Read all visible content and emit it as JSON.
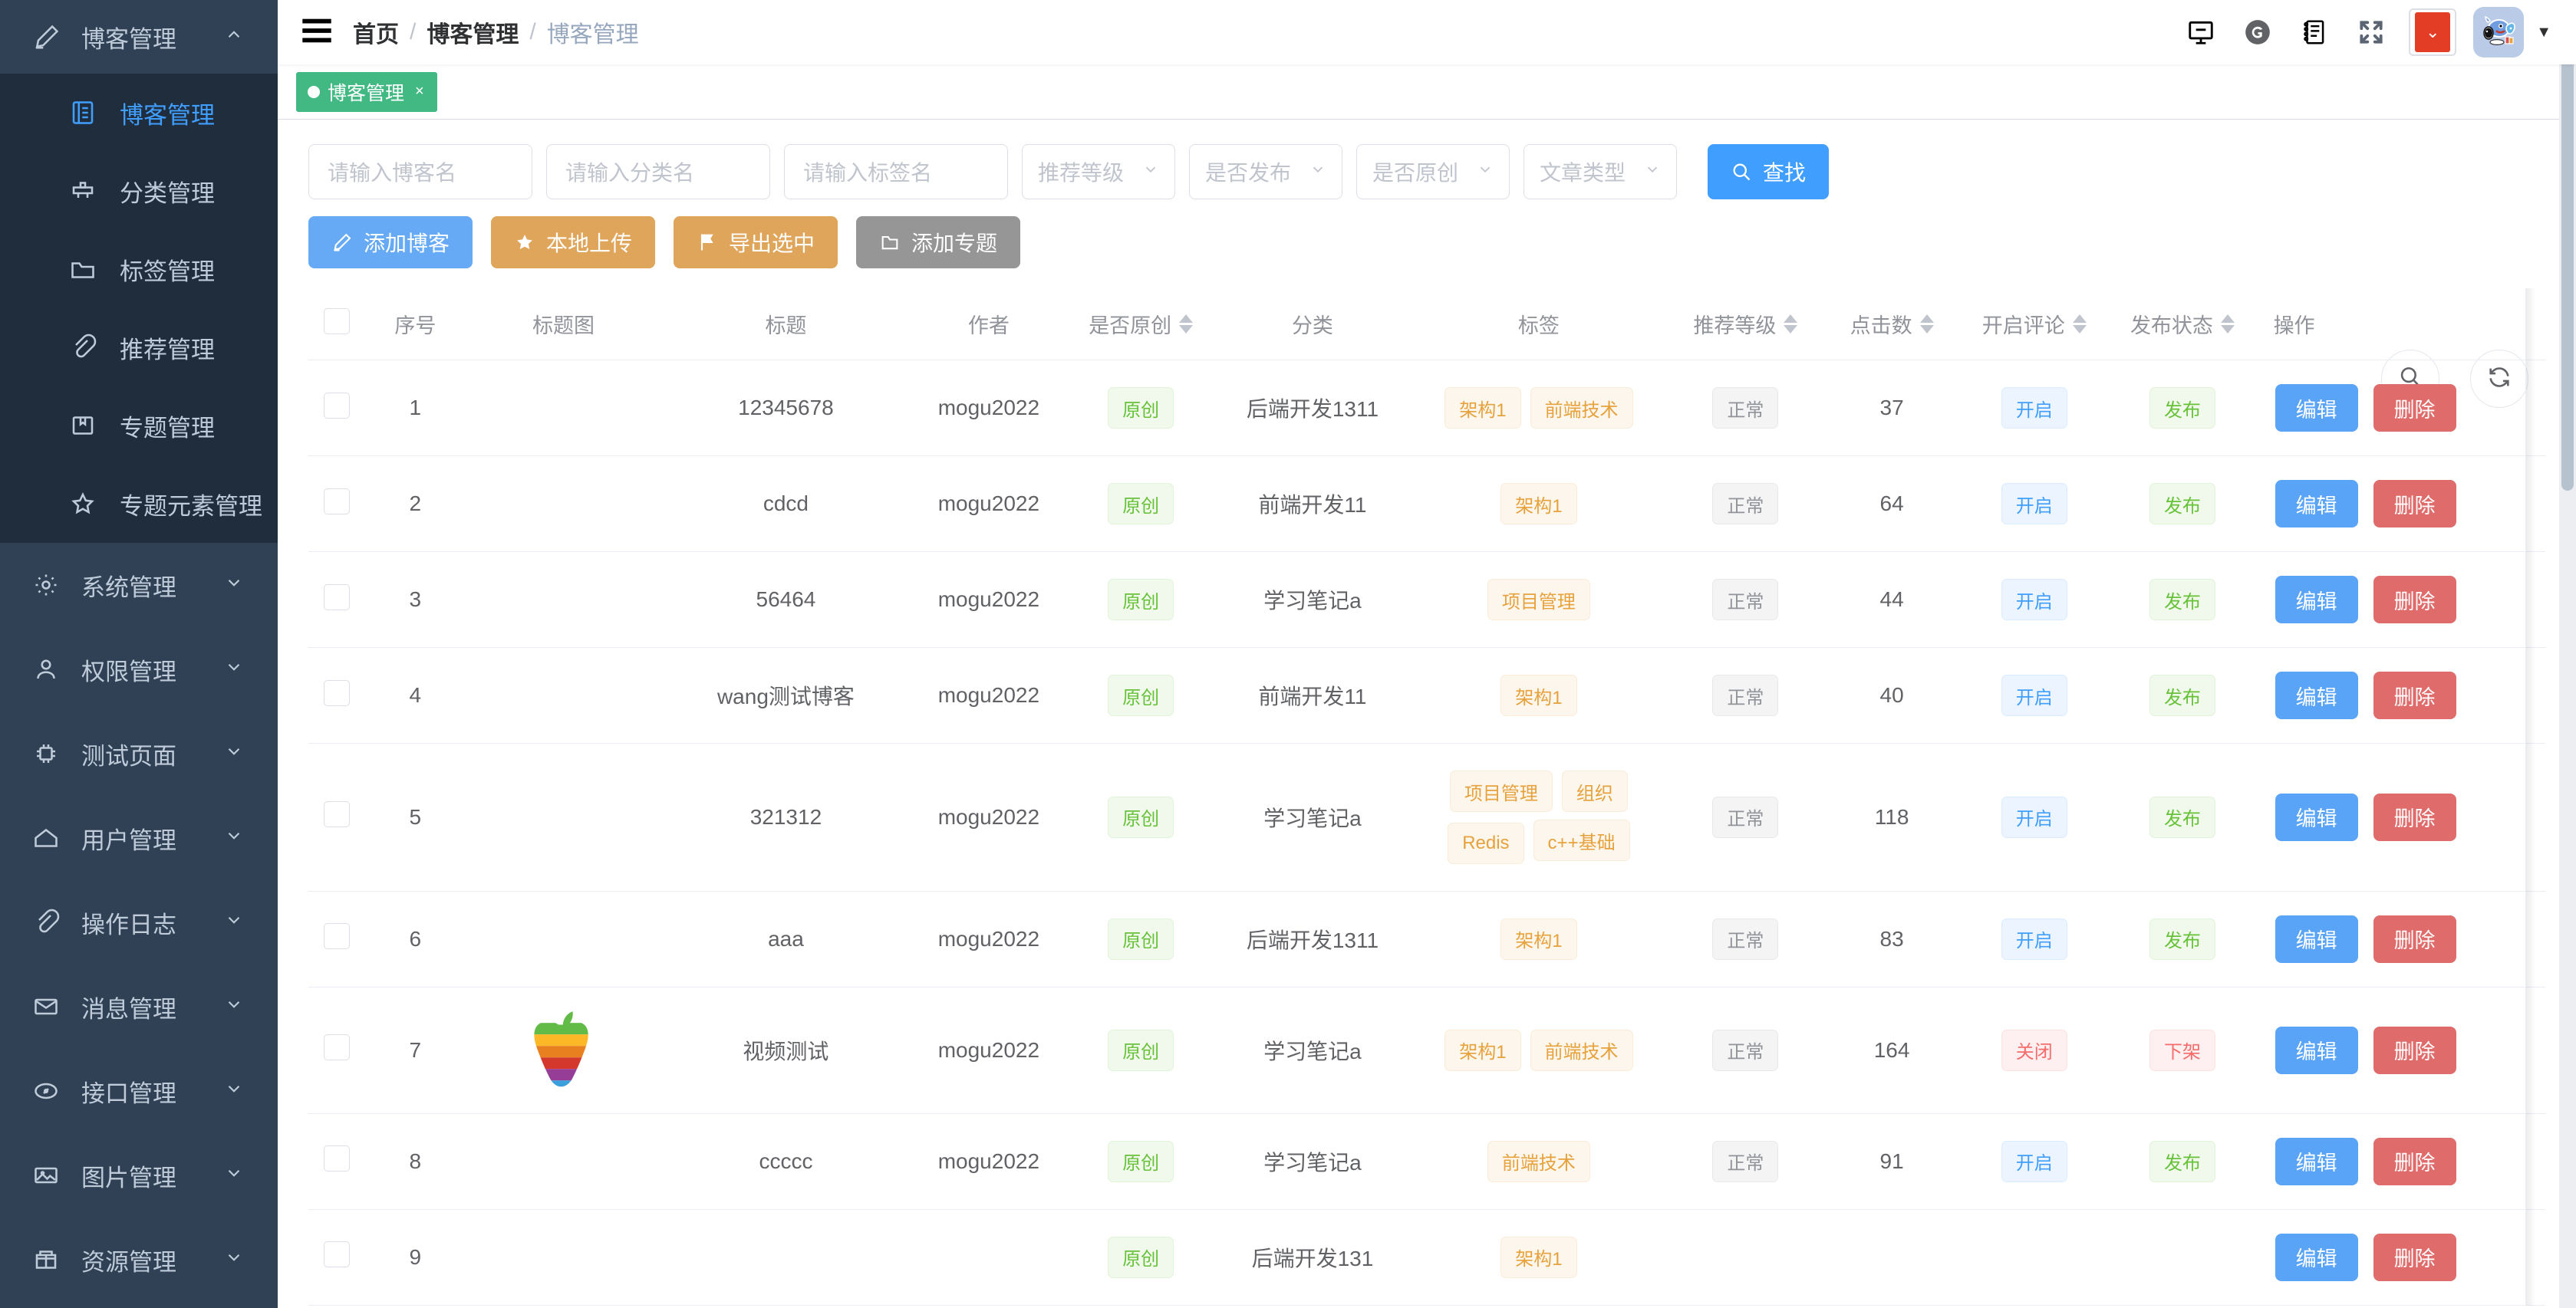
{
  "sidebar": {
    "group": {
      "label": "博客管理",
      "icon": "pencil-icon",
      "arrow": "chevron-up-icon"
    },
    "sub_items": [
      {
        "label": "博客管理",
        "icon": "book-icon",
        "active": true
      },
      {
        "label": "分类管理",
        "icon": "category-icon",
        "active": false
      },
      {
        "label": "标签管理",
        "icon": "folder-icon",
        "active": false
      },
      {
        "label": "推荐管理",
        "icon": "paperclip-icon",
        "active": false
      },
      {
        "label": "专题管理",
        "icon": "bookmark-icon",
        "active": false
      },
      {
        "label": "专题元素管理",
        "icon": "star-icon",
        "active": false
      }
    ],
    "root_items": [
      {
        "label": "系统管理",
        "icon": "gear-icon"
      },
      {
        "label": "权限管理",
        "icon": "user-icon"
      },
      {
        "label": "测试页面",
        "icon": "chip-icon"
      },
      {
        "label": "用户管理",
        "icon": "home-icon"
      },
      {
        "label": "操作日志",
        "icon": "paperclip-icon"
      },
      {
        "label": "消息管理",
        "icon": "envelope-icon"
      },
      {
        "label": "接口管理",
        "icon": "gauge-icon"
      },
      {
        "label": "图片管理",
        "icon": "image-icon"
      },
      {
        "label": "资源管理",
        "icon": "archive-icon"
      }
    ]
  },
  "navbar": {
    "hamburger_icon": "hamburger-icon",
    "breadcrumb": [
      {
        "label": "首页",
        "current": false
      },
      {
        "label": "博客管理",
        "current": false
      },
      {
        "label": "博客管理",
        "current": true
      }
    ],
    "separator": "/",
    "icons": [
      {
        "name": "screenfull-monitor-icon"
      },
      {
        "name": "github-icon"
      },
      {
        "name": "notebook-icon"
      },
      {
        "name": "fullscreen-icon"
      }
    ],
    "error_log": {
      "name": "error-log-button",
      "glyph": "⌄"
    },
    "avatar_name": "user-avatar",
    "caret": "▼"
  },
  "tagbar": {
    "tags": [
      {
        "label": "博客管理",
        "close": "×",
        "active": true
      }
    ]
  },
  "filters": {
    "inputs": [
      {
        "placeholder": "请输入博客名",
        "value": "",
        "name": "blog-name-input"
      },
      {
        "placeholder": "请输入分类名",
        "value": "",
        "name": "category-name-input"
      },
      {
        "placeholder": "请输入标签名",
        "value": "",
        "name": "tag-name-input"
      }
    ],
    "selects": [
      {
        "placeholder": "推荐等级",
        "value": "",
        "name": "recommend-level-select"
      },
      {
        "placeholder": "是否发布",
        "value": "",
        "name": "is-publish-select"
      },
      {
        "placeholder": "是否原创",
        "value": "",
        "name": "is-original-select"
      },
      {
        "placeholder": "文章类型",
        "value": "",
        "name": "article-type-select"
      }
    ],
    "search_button": {
      "label": "查找",
      "icon": "search-icon"
    }
  },
  "actions": [
    {
      "label": "添加博客",
      "icon": "pencil-icon",
      "style": "primary"
    },
    {
      "label": "本地上传",
      "icon": "star-icon",
      "style": "warning"
    },
    {
      "label": "导出选中",
      "icon": "flag-icon",
      "style": "warning"
    },
    {
      "label": "添加专题",
      "icon": "folder-icon",
      "style": "info"
    }
  ],
  "float_buttons": [
    {
      "name": "search-float-button",
      "icon": "search-icon"
    },
    {
      "name": "refresh-float-button",
      "icon": "refresh-icon"
    }
  ],
  "table": {
    "columns": [
      {
        "label": "",
        "key": "checkbox",
        "sortable": false
      },
      {
        "label": "序号",
        "key": "index",
        "sortable": false
      },
      {
        "label": "标题图",
        "key": "cover",
        "sortable": false
      },
      {
        "label": "标题",
        "key": "title",
        "sortable": false
      },
      {
        "label": "作者",
        "key": "author",
        "sortable": false
      },
      {
        "label": "是否原创",
        "key": "original",
        "sortable": true
      },
      {
        "label": "分类",
        "key": "category",
        "sortable": false
      },
      {
        "label": "标签",
        "key": "tags",
        "sortable": false
      },
      {
        "label": "推荐等级",
        "key": "level",
        "sortable": true
      },
      {
        "label": "点击数",
        "key": "clicks",
        "sortable": true
      },
      {
        "label": "开启评论",
        "key": "comment",
        "sortable": true
      },
      {
        "label": "发布状态",
        "key": "status",
        "sortable": true
      },
      {
        "label": "操作",
        "key": "ops",
        "sortable": false
      }
    ],
    "row_ops": {
      "edit": "编辑",
      "delete": "删除"
    },
    "rows": [
      {
        "index": "1",
        "cover": "",
        "title": "12345678",
        "author": "mogu2022",
        "original": "原创",
        "category": "后端开发1311",
        "tags": [
          "架构1",
          "前端技术"
        ],
        "level": "正常",
        "clicks": "37",
        "comment": "开启",
        "comment_state": "on",
        "status": "发布",
        "status_state": "on"
      },
      {
        "index": "2",
        "cover": "",
        "title": "cdcd",
        "author": "mogu2022",
        "original": "原创",
        "category": "前端开发11",
        "tags": [
          "架构1"
        ],
        "level": "正常",
        "clicks": "64",
        "comment": "开启",
        "comment_state": "on",
        "status": "发布",
        "status_state": "on"
      },
      {
        "index": "3",
        "cover": "",
        "title": "56464",
        "author": "mogu2022",
        "original": "原创",
        "category": "学习笔记a",
        "tags": [
          "项目管理"
        ],
        "level": "正常",
        "clicks": "44",
        "comment": "开启",
        "comment_state": "on",
        "status": "发布",
        "status_state": "on"
      },
      {
        "index": "4",
        "cover": "",
        "title": "wang测试博客",
        "author": "mogu2022",
        "original": "原创",
        "category": "前端开发11",
        "tags": [
          "架构1"
        ],
        "level": "正常",
        "clicks": "40",
        "comment": "开启",
        "comment_state": "on",
        "status": "发布",
        "status_state": "on"
      },
      {
        "index": "5",
        "cover": "",
        "title": "321312",
        "author": "mogu2022",
        "original": "原创",
        "category": "学习笔记a",
        "tags": [
          "项目管理",
          "组织",
          "Redis",
          "c++基础"
        ],
        "level": "正常",
        "clicks": "118",
        "comment": "开启",
        "comment_state": "on",
        "status": "发布",
        "status_state": "on"
      },
      {
        "index": "6",
        "cover": "",
        "title": "aaa",
        "author": "mogu2022",
        "original": "原创",
        "category": "后端开发1311",
        "tags": [
          "架构1"
        ],
        "level": "正常",
        "clicks": "83",
        "comment": "开启",
        "comment_state": "on",
        "status": "发布",
        "status_state": "on"
      },
      {
        "index": "7",
        "cover": "apple-logo",
        "title": "视频测试",
        "author": "mogu2022",
        "original": "原创",
        "category": "学习笔记a",
        "tags": [
          "架构1",
          "前端技术"
        ],
        "level": "正常",
        "clicks": "164",
        "comment": "关闭",
        "comment_state": "off",
        "status": "下架",
        "status_state": "off"
      },
      {
        "index": "8",
        "cover": "",
        "title": "ccccc",
        "author": "mogu2022",
        "original": "原创",
        "category": "学习笔记a",
        "tags": [
          "前端技术"
        ],
        "level": "正常",
        "clicks": "91",
        "comment": "开启",
        "comment_state": "on",
        "status": "发布",
        "status_state": "on"
      },
      {
        "index": "9",
        "cover": "",
        "title": "",
        "author": "",
        "original": "原创",
        "category": "后端开发131",
        "tags": [
          "架构1"
        ],
        "level": "",
        "clicks": "",
        "comment": "",
        "comment_state": "on",
        "status": "",
        "status_state": "on"
      }
    ]
  },
  "colors": {
    "sidebar_bg": "#304156",
    "sidebar_sub_bg": "#1f2d3d",
    "accent": "#409EFF",
    "tag_active": "#42b983",
    "warning": "#dfa55a",
    "danger": "#e06b6b",
    "info": "#969696"
  }
}
